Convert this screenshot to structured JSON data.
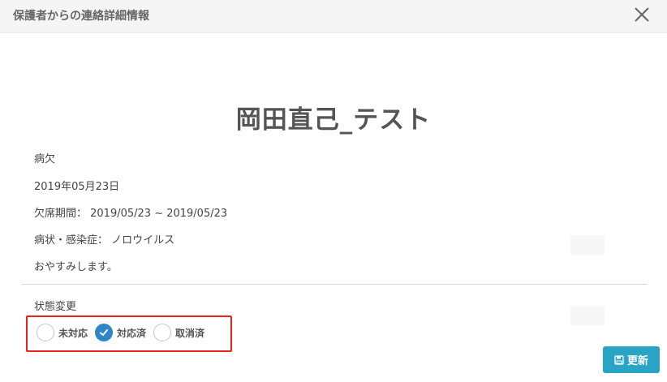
{
  "modal": {
    "title": "保護者からの連絡詳細情報"
  },
  "student": {
    "name": "岡田直己_テスト"
  },
  "contact": {
    "type": "病欠",
    "date": "2019年05月23日",
    "absence_period": "欠席期間： 2019/05/23 ~ 2019/05/23",
    "symptom": "病状・感染症： ノロウイルス",
    "message": "おやすみします。"
  },
  "status": {
    "title": "状態変更",
    "options": [
      {
        "label": "未対応",
        "checked": false
      },
      {
        "label": "対応済",
        "checked": true
      },
      {
        "label": "取消済",
        "checked": false
      }
    ],
    "accent_color": "#2e86c8",
    "highlight_color": "#e8231c"
  },
  "actions": {
    "update_label": "更新",
    "update_color": "#2aa4c4"
  },
  "icons": {
    "close": "close-icon",
    "checkmark": "check-icon",
    "save": "floppy-disk-icon"
  }
}
